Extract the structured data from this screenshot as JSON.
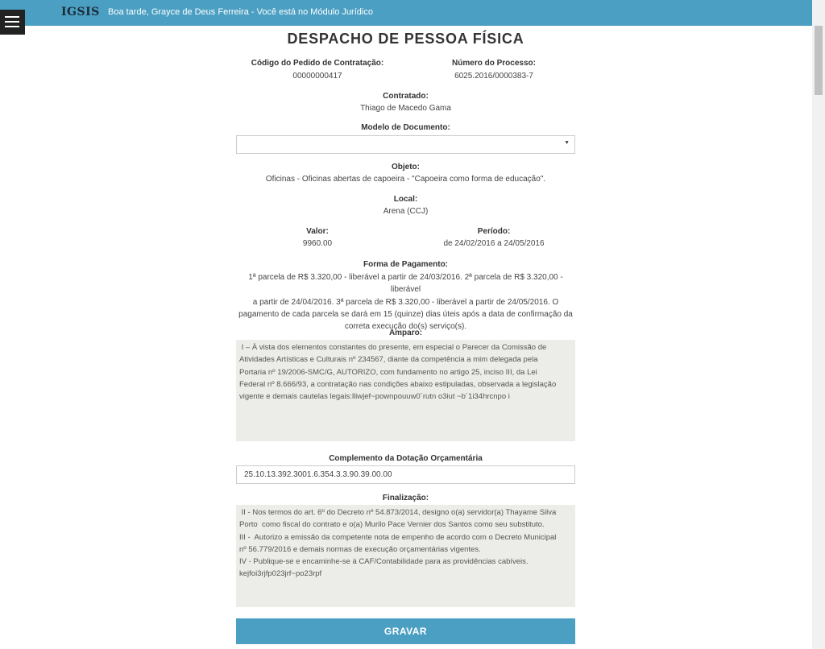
{
  "header": {
    "brand": "IGSIS",
    "greeting": "Boa tarde, Grayce de Deus Ferreira - Você está no Módulo Jurídico"
  },
  "page": {
    "title": "DESPACHO DE PESSOA FÍSICA"
  },
  "form": {
    "pedido_label": "Código do Pedido de Contratação:",
    "pedido_value": "00000000417",
    "processo_label": "Número do Processo:",
    "processo_value": "6025.2016/0000383-7",
    "contratado_label": "Contratado:",
    "contratado_value": "Thiago de Macedo Gama",
    "modelo_label": "Modelo de Documento:",
    "modelo_selected": "",
    "objeto_label": "Objeto:",
    "objeto_value": "Oficinas - Oficinas abertas de capoeira - \"Capoeira como forma de educação\".",
    "local_label": "Local:",
    "local_value": "Arena (CCJ)",
    "valor_label": "Valor:",
    "valor_value": "9960.00",
    "periodo_label": "Período:",
    "periodo_value": "de 24/02/2016 a 24/05/2016",
    "pagamento_label": "Forma de Pagamento:",
    "pagamento_lines": [
      "1ª parcela de R$ 3.320,00 - liberável a partir de 24/03/2016. 2ª parcela de R$ 3.320,00 - liberável",
      "a partir de 24/04/2016. 3ª parcela de R$ 3.320,00 - liberável a partir de 24/05/2016. O",
      "pagamento de cada parcela se dará em 15 (quinze) dias úteis após a data de confirmação da",
      "correta execução do(s) serviço(s)."
    ],
    "amparo_label": "Amparo:",
    "amparo_text": " I – À vista dos elementos constantes do presente, em especial o Parecer da Comissão de\nAtividades Artísticas e Culturais nº 234567, diante da competência a mim delegada pela\nPortaria nº 19/2006-SMC/G, AUTORIZO, com fundamento no artigo 25, inciso III, da Lei\nFederal nº 8.666/93, a contratação nas condições abaixo estipuladas, observada a legislação\nvigente e demais cautelas legais:lliwjef~pownpouuw0´rutn o3iut ~b´1i34hrcnpo i",
    "dotacao_label": "Complemento da Dotação Orçamentária",
    "dotacao_value": "25.10.13.392.3001.6.354.3.3.90.39.00.00",
    "finalizacao_label": "Finalização:",
    "finalizacao_text": " II - Nos termos do art. 6º do Decreto nº 54.873/2014, designo o(a) servidor(a) Thayame Silva\nPorto  como fiscal do contrato e o(a) Murilo Pace Vernier dos Santos como seu substituto.\nIII -  Autorizo a emissão da competente nota de empenho de acordo com o Decreto Municipal\nnº 56.779/2016 e demais normas de execução orçamentárias vigentes.\nIV - Publique-se e encaminhe-se à CAF/Contabilidade para as providências cabíveis.\nkejfoi3rjfp023jrf~po23rpf",
    "submit_label": "GRAVAR"
  }
}
